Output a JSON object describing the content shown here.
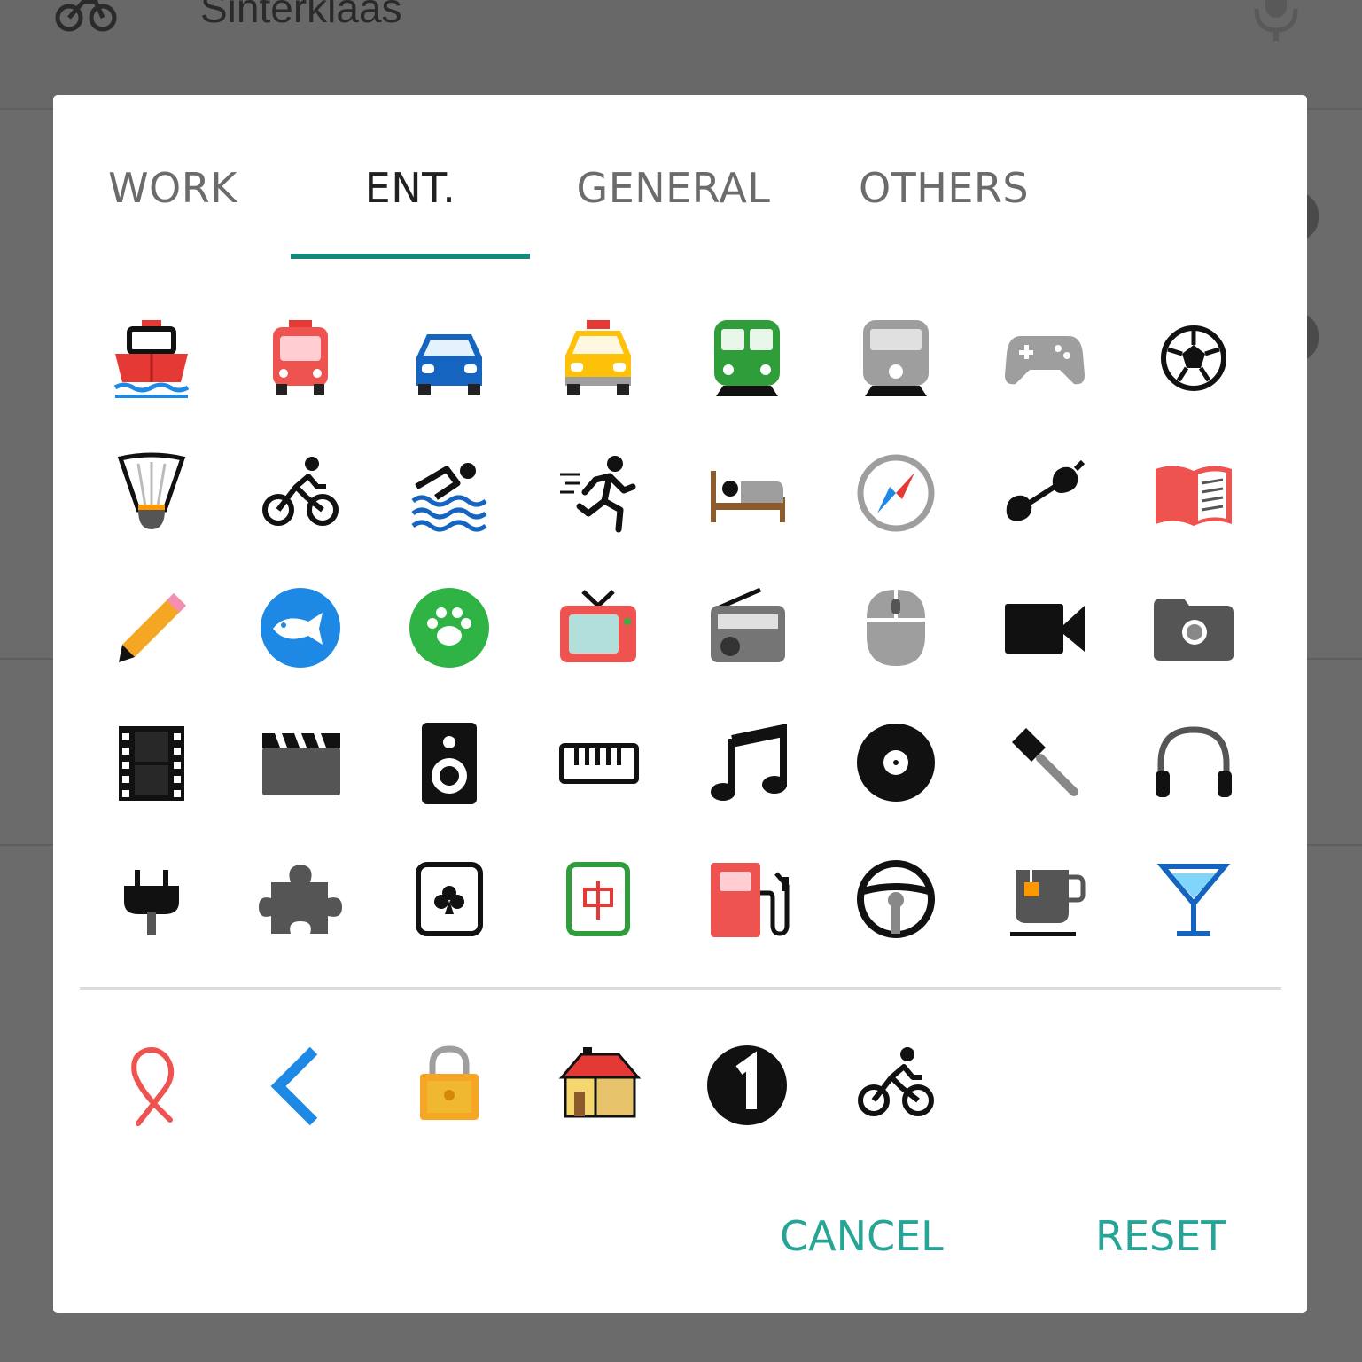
{
  "background": {
    "title": "Sinterklaas"
  },
  "tabs": [
    {
      "label": "WORK",
      "active": false
    },
    {
      "label": "ENT.",
      "active": true
    },
    {
      "label": "GENERAL",
      "active": false
    },
    {
      "label": "OTHERS",
      "active": false
    }
  ],
  "icons": [
    "ship-icon",
    "bus-icon",
    "car-icon",
    "taxi-icon",
    "train-icon",
    "metro-icon",
    "gamepad-icon",
    "soccer-ball-icon",
    "shuttlecock-icon",
    "cyclist-icon",
    "swimmer-icon",
    "runner-icon",
    "bed-icon",
    "compass-icon",
    "sunglasses-icon",
    "open-book-icon",
    "pencil-icon",
    "fish-icon",
    "paw-icon",
    "tv-icon",
    "radio-icon",
    "mouse-icon",
    "video-camera-icon",
    "camera-icon",
    "film-strip-icon",
    "clapperboard-icon",
    "speaker-icon",
    "keyboard-icon",
    "music-note-icon",
    "vinyl-record-icon",
    "microphone-icon",
    "headphones-icon",
    "plug-icon",
    "puzzle-piece-icon",
    "card-club-icon",
    "mahjong-tile-icon",
    "fuel-pump-icon",
    "steering-wheel-icon",
    "tea-cup-icon",
    "cocktail-glass-icon"
  ],
  "recent_icons": [
    "ribbon-icon",
    "chevron-left-icon",
    "padlock-icon",
    "house-icon",
    "number-one-icon",
    "cyclist-icon"
  ],
  "actions": {
    "cancel": "CANCEL",
    "reset": "RESET"
  },
  "colors": {
    "accent": "#17897a",
    "button_text": "#26a596"
  }
}
